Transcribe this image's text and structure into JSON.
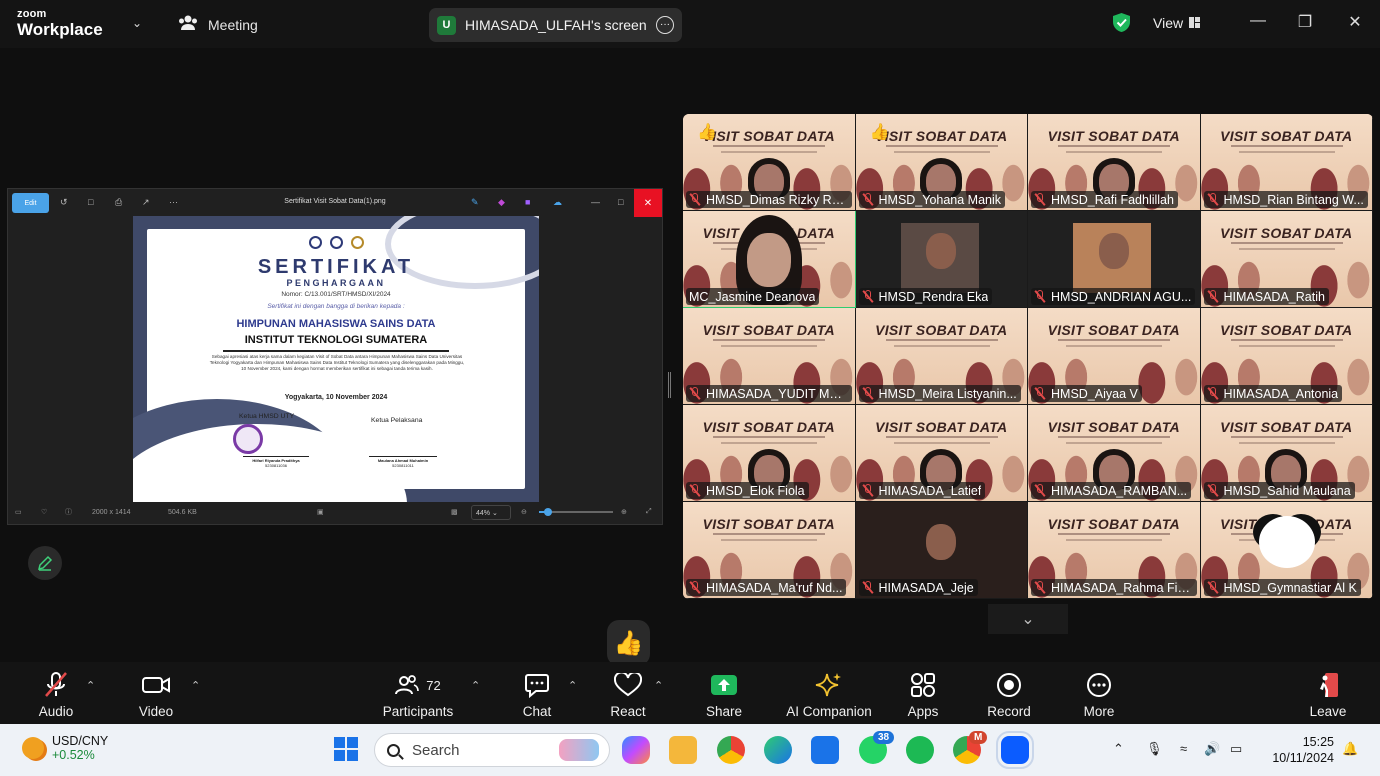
{
  "app": {
    "logo_top": "zoom",
    "logo_bottom": "Workplace",
    "meeting_label": "Meeting",
    "share_initial": "U",
    "share_title": "HIMASADA_ULFAH's screen",
    "view_label": "View"
  },
  "viewer": {
    "edit_label": "Edit",
    "file_title": "Sertifikat Visit Sobat Data(1).png",
    "dimensions": "2000 x 1414",
    "file_size": "504.6 KB",
    "zoom": "44%"
  },
  "certificate": {
    "title": "SERTIFIKAT",
    "subtitle": "PENGHARGAAN",
    "nomor": "Nomor: C/13.001/SRT/HMSD/XI/2024",
    "given": "Sertifikat ini dengan bangga di berikan kepada :",
    "org1": "HIMPUNAN MAHASISWA SAINS DATA",
    "org2": "INSTITUT TEKNOLOGI SUMATERA",
    "body": "Sebagai apresiasi atas kerja sama dalam kegiatan Visit of Sobat Data antara Himpunan Mahasiswa Sains Data Universitas Teknologi Yogyakarta dan Himpunan Mahasiswa Sains Data Institut Teknologi Sumatera yang diselenggarakan pada Minggu, 10 November 2024, kami dengan hormat memberikan sertifikat ini sebagai tanda terima kasih.",
    "place_date": "Yogyakarta, 10 November 2024",
    "sign1_role": "Ketua HMSD UTY",
    "sign1_name": "Hilfari Riyanda Pradithya",
    "sign1_id": "5230811036",
    "sign2_role": "Ketua Pelaksana",
    "sign2_name": "Maulana Ahmad Muhaimin",
    "sign2_id": "5230811011"
  },
  "gallery": {
    "background_text": "VISIT SOBAT DATA",
    "participants": [
      {
        "name": "HMSD_Dimas Rizky Ra...",
        "muted": true
      },
      {
        "name": "HMSD_Yohana Manik",
        "muted": true
      },
      {
        "name": "HMSD_Rafi Fadhlillah",
        "muted": true
      },
      {
        "name": "HMSD_Rian Bintang W...",
        "muted": true
      },
      {
        "name": "MC_Jasmine Deanova",
        "muted": false
      },
      {
        "name": "HMSD_Rendra Eka",
        "muted": true
      },
      {
        "name": "HMSD_ANDRIAN AGU...",
        "muted": true
      },
      {
        "name": "HIMASADA_Ratih",
        "muted": true
      },
      {
        "name": "HIMASADA_YUDIT MA...",
        "muted": true
      },
      {
        "name": "HMSD_Meira Listyanin...",
        "muted": true
      },
      {
        "name": "HMSD_Aiyaa V",
        "muted": true
      },
      {
        "name": "HIMASADA_Antonia",
        "muted": true
      },
      {
        "name": "HMSD_Elok Fiola",
        "muted": true
      },
      {
        "name": "HIMASADA_Latief",
        "muted": true
      },
      {
        "name": "HIMASADA_RAMBAN...",
        "muted": true
      },
      {
        "name": "HMSD_Sahid Maulana",
        "muted": true
      },
      {
        "name": "HIMASADA_Ma'ruf Nd...",
        "muted": true
      },
      {
        "name": "HIMASADA_Jeje",
        "muted": true
      },
      {
        "name": "HIMASADA_Rahma Fie...",
        "muted": true
      },
      {
        "name": "HMSD_Gymnastiar Al K",
        "muted": true
      }
    ]
  },
  "toolbar": {
    "audio": "Audio",
    "video": "Video",
    "participants": "Participants",
    "participants_count": "72",
    "chat": "Chat",
    "react": "React",
    "share": "Share",
    "ai_companion": "AI Companion",
    "apps": "Apps",
    "record": "Record",
    "more": "More",
    "leave": "Leave"
  },
  "taskbar": {
    "ticker": "USD/CNY",
    "change": "+0.52%",
    "search_placeholder": "Search",
    "whatsapp_badge": "38",
    "chrome_badge": "M",
    "time": "15:25",
    "date": "10/11/2024"
  },
  "colors": {
    "zoom_bg": "#0f0f0f",
    "active_speaker": "#2ecc71",
    "muted_red": "#e24a4a",
    "share_green": "#1fb85c",
    "cert_navy": "#2e3a6e"
  }
}
